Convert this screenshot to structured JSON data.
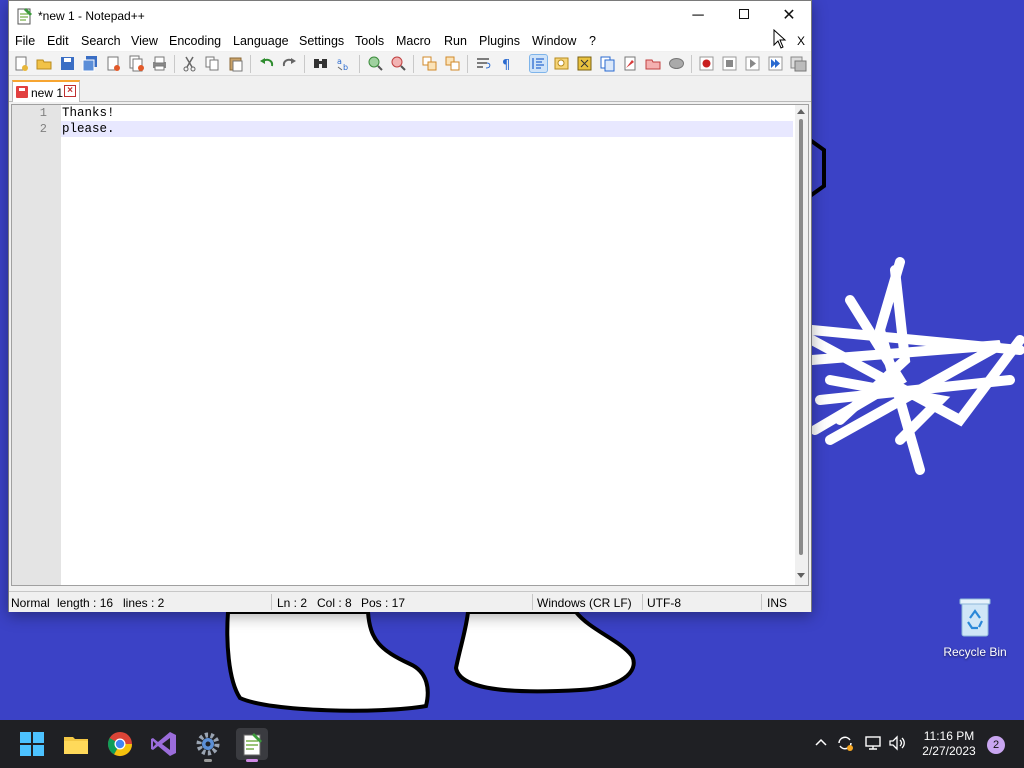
{
  "window": {
    "title": "*new 1 - Notepad++",
    "controls": {
      "minimize": "─",
      "maximize": "",
      "close": "✕"
    }
  },
  "menu": {
    "items": [
      "File",
      "Edit",
      "Search",
      "View",
      "Encoding",
      "Language",
      "Settings",
      "Tools",
      "Macro",
      "Run",
      "Plugins",
      "Window",
      "?"
    ],
    "close_doc": "X"
  },
  "toolbar": {
    "buttons": [
      "new-file",
      "open-file",
      "save",
      "save-all",
      "close",
      "close-all",
      "print",
      "cut",
      "copy",
      "paste",
      "undo",
      "redo",
      "find",
      "replace",
      "zoom-in",
      "zoom-out",
      "sync-vertical",
      "sync-horizontal",
      "word-wrap",
      "show-all-chars",
      "indent-guide",
      "define-language",
      "document-map",
      "function-list",
      "folder-as-workspace",
      "monitoring",
      "record-macro",
      "stop-recording",
      "playback-macro",
      "run-macro-multiple",
      "save-macro"
    ],
    "active": [
      "indent-guide"
    ]
  },
  "tabs": [
    {
      "label": "new 1",
      "modified": true
    }
  ],
  "editor": {
    "lines": [
      {
        "number": "1",
        "text": "Thanks!"
      },
      {
        "number": "2",
        "text": "please."
      }
    ],
    "current_line": 2
  },
  "status": {
    "mode": "Normal",
    "length": "length : 16",
    "lines": "lines : 2",
    "ln": "Ln : 2",
    "col": "Col : 8",
    "pos": "Pos : 17",
    "eol": "Windows (CR LF)",
    "encoding": "UTF-8",
    "insert": "INS"
  },
  "desktop": {
    "recycle_bin_label": "Recycle Bin"
  },
  "taskbar": {
    "apps": [
      "start-icon",
      "file-explorer-icon",
      "chrome-icon",
      "visual-studio-icon",
      "settings-icon",
      "notepad-plus-plus-icon"
    ],
    "tray": [
      "chevron-up-icon",
      "sync-icon",
      "network-icon",
      "volume-icon"
    ],
    "time": "11:16 PM",
    "date": "2/27/2023",
    "notifications": "2"
  },
  "colors": {
    "desktop": "#3b42c6",
    "current_line": "#e8e8ff",
    "tab_accent": "#f7a531",
    "taskbar": "#1f2024"
  }
}
